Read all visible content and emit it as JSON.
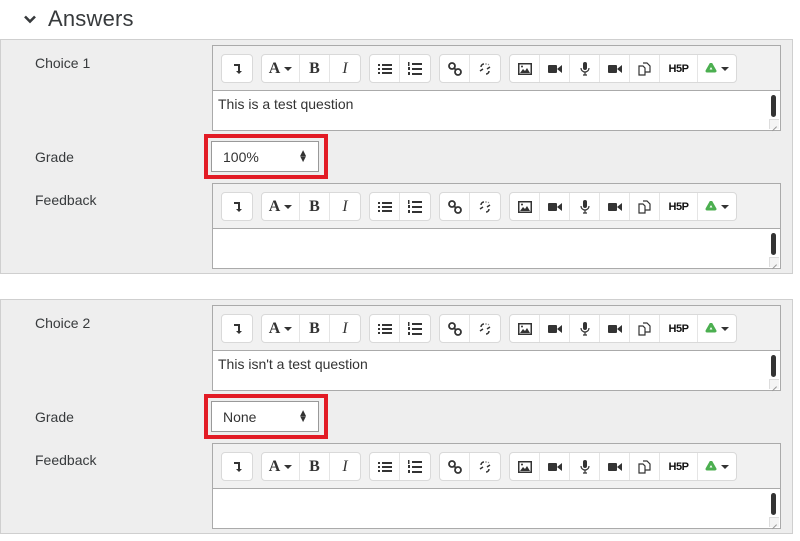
{
  "section": {
    "title": "Answers",
    "icon": "chevron-down-icon"
  },
  "toolbar": {
    "groups": [
      [
        {
          "name": "show-more-buttons",
          "icon": "collapse-icon"
        }
      ],
      [
        {
          "name": "font-style",
          "label": "A",
          "icon": "font-icon"
        },
        {
          "name": "bold",
          "label": "B"
        },
        {
          "name": "italic",
          "label": "I"
        }
      ],
      [
        {
          "name": "unordered-list",
          "icon": "bullet-list-icon"
        },
        {
          "name": "ordered-list",
          "icon": "numbered-list-icon"
        }
      ],
      [
        {
          "name": "link",
          "icon": "link-icon"
        },
        {
          "name": "unlink",
          "icon": "unlink-icon"
        }
      ],
      [
        {
          "name": "insert-image",
          "icon": "image-icon"
        },
        {
          "name": "insert-media",
          "icon": "video-camera-icon"
        },
        {
          "name": "record-audio",
          "icon": "microphone-icon"
        },
        {
          "name": "record-video",
          "icon": "video-camera-icon"
        },
        {
          "name": "manage-files",
          "icon": "files-icon"
        },
        {
          "name": "insert-h5p",
          "label": "H5P",
          "icon": "h5p-icon"
        },
        {
          "name": "recycle-dropdown",
          "icon": "recycle-icon"
        }
      ]
    ],
    "colors": {
      "recycle": "#4caf50",
      "accent_border": "#e21b25"
    }
  },
  "answers": [
    {
      "choice_label": "Choice 1",
      "choice_text": "This is a test question",
      "grade_label": "Grade",
      "grade_value": "100%",
      "feedback_label": "Feedback",
      "feedback_text": ""
    },
    {
      "choice_label": "Choice 2",
      "choice_text": "This isn't a test question",
      "grade_label": "Grade",
      "grade_value": "None",
      "feedback_label": "Feedback",
      "feedback_text": ""
    }
  ]
}
